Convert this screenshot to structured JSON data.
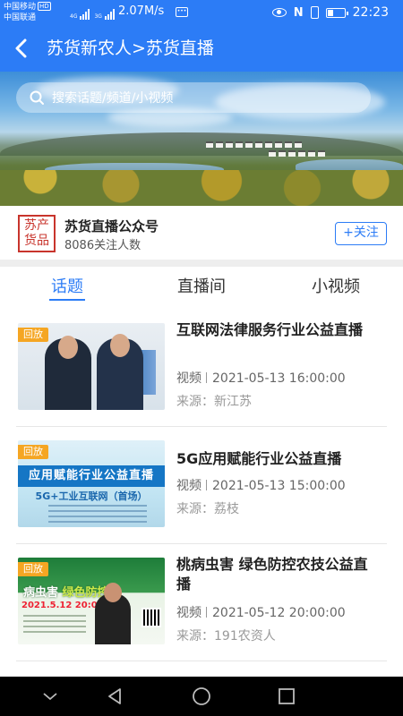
{
  "status_bar": {
    "carrier1": "中国移动",
    "carrier1_badge": "HD",
    "carrier2": "中国联通",
    "network1": "4G",
    "network2": "3G",
    "speed": "2.07M/s",
    "time": "22:23"
  },
  "header": {
    "title": "苏货新农人>苏货直播"
  },
  "search": {
    "placeholder": "搜索话题/频道/小视频"
  },
  "account": {
    "logo_line1": "苏产",
    "logo_line2": "货品",
    "name": "苏货直播公众号",
    "followers": "8086关注人数",
    "follow_label": "+关注"
  },
  "tabs": [
    {
      "label": "话题",
      "active": true
    },
    {
      "label": "直播间",
      "active": false
    },
    {
      "label": "小视频",
      "active": false
    }
  ],
  "items": [
    {
      "tag": "回放",
      "title": "互联网法律服务行业公益直播",
      "type": "视频",
      "datetime": "2021-05-13 16:00:00",
      "source": "来源：新江苏"
    },
    {
      "tag": "回放",
      "title": "5G应用赋能行业公益直播",
      "type": "视频",
      "datetime": "2021-05-13 15:00:00",
      "source": "来源：荔枝",
      "thumb_banner": "应用赋能行业公益直播",
      "thumb_sub": "5G+工业互联网（首场）"
    },
    {
      "tag": "回放",
      "title": "桃病虫害 绿色防控农技公益直播",
      "type": "视频",
      "datetime": "2021-05-12 20:00:00",
      "source": "来源：191农资人",
      "thumb_title_a": "病虫害 ",
      "thumb_title_b": "绿色防控",
      "thumb_date": "2021.5.12 20:00"
    }
  ],
  "colors": {
    "brand_blue": "#2c7cf6",
    "tag_orange": "#f5a623"
  }
}
